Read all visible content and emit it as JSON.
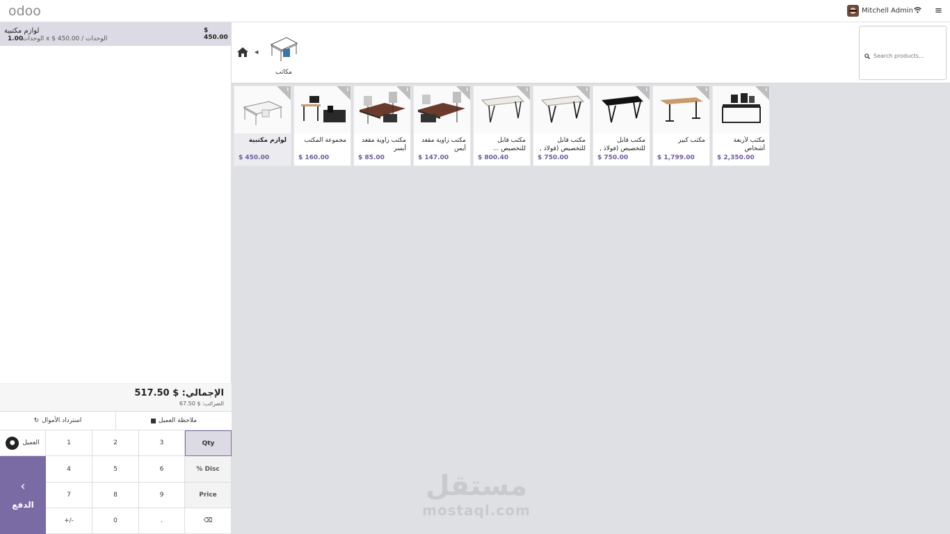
{
  "topbar": {
    "logo": "odoo",
    "user_name": "Mitchell Admin"
  },
  "order": {
    "line": {
      "name": "لوازم مكتبية",
      "price": "$ 450.00",
      "qty": "1.00",
      "unit_text": "الوحدات x $ 450.00 / الوحدات"
    },
    "total": "الإجمالي: $ 517.50",
    "taxes": "الضرائب: $ 67.50"
  },
  "actions": {
    "refund": "استرداد الأموال",
    "customer_note": "ملاحظة العميل"
  },
  "pad": {
    "customer": "العميل",
    "pay": "الدفع",
    "keys": [
      "1",
      "2",
      "3",
      "Qty",
      "4",
      "5",
      "6",
      "% Disc",
      "7",
      "8",
      "9",
      "Price",
      "+/-",
      "0",
      ".",
      "⌫"
    ],
    "active_mode": "Qty"
  },
  "categories": {
    "current": "مكاتب"
  },
  "search": {
    "placeholder": "Search products..."
  },
  "products": [
    {
      "name": "لوازم مكتبية",
      "price": "$ 450.00"
    },
    {
      "name": "مجموعة المكتب",
      "price": "$ 160.00"
    },
    {
      "name": "مكتب زاوية مقعد أيسر",
      "price": "$ 85.00"
    },
    {
      "name": "مكتب زاوية مقعد أيمن",
      "price": "$ 147.00"
    },
    {
      "name": "مكتب قابل للتخصيص ...",
      "price": "$ 800.40"
    },
    {
      "name": "مكتب قابل للتخصيص (فولاذ ,",
      "price": "$ 750.00"
    },
    {
      "name": "مكتب قابل للتخصيص (فولاذ ,",
      "price": "$ 750.00"
    },
    {
      "name": "مكتب كبير",
      "price": "$ 1,799.00"
    },
    {
      "name": "مكتب لأربعة أشخاص",
      "price": "$ 2,350.00"
    }
  ],
  "watermark": {
    "arabic": "مستقل",
    "latin": "mostaql.com"
  }
}
